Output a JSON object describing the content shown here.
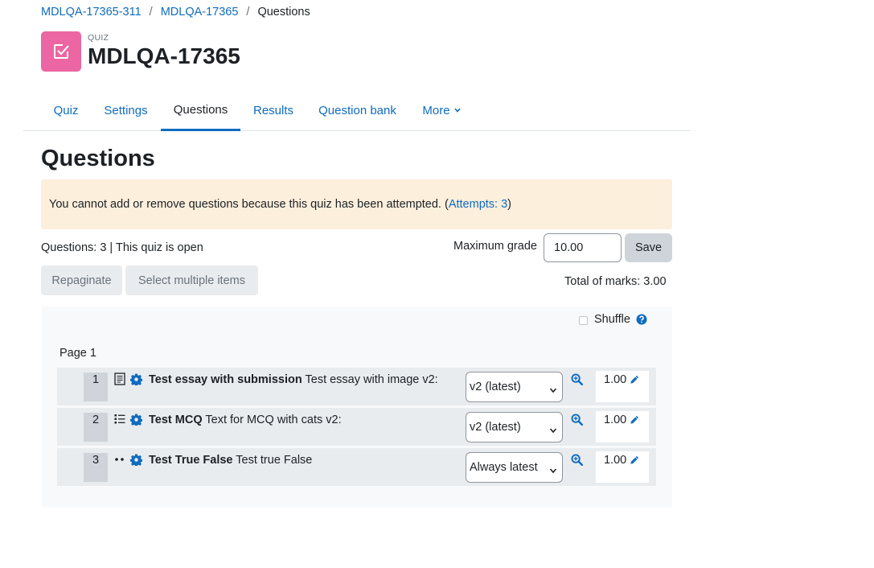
{
  "breadcrumb": {
    "item1": "MDLQA-17365-311",
    "item2": "MDLQA-17365",
    "current": "Questions",
    "sep": "/"
  },
  "header": {
    "kicker": "QUIZ",
    "title": "MDLQA-17365",
    "icon": "quiz-checkbox-icon"
  },
  "tabs": {
    "quiz": "Quiz",
    "settings": "Settings",
    "questions": "Questions",
    "results": "Results",
    "bank": "Question bank",
    "more": "More"
  },
  "page_heading": "Questions",
  "alert": {
    "text": "You cannot add or remove questions because this quiz has been attempted. (",
    "link": "Attempts: 3",
    "close_paren": ")"
  },
  "status_text": "Questions: 3 | This quiz is open",
  "max_grade": {
    "label": "Maximum grade",
    "value": "10.00",
    "save": "Save"
  },
  "buttons": {
    "repaginate": "Repaginate",
    "select_multiple": "Select multiple items"
  },
  "total_marks": "Total of marks: 3.00",
  "shuffle_label": "Shuffle",
  "page_label": "Page 1",
  "colors": {
    "accent": "#0f6cbf",
    "quiz_icon_bg": "#eb66a2",
    "alert_bg": "#fcefdc"
  },
  "questions": [
    {
      "num": "1",
      "icon": "essay-icon",
      "name": "Test essay with submission",
      "desc": "Test essay with image v2:",
      "version": "v2 (latest)",
      "mark": "1.00"
    },
    {
      "num": "2",
      "icon": "multichoice-icon",
      "name": "Test MCQ",
      "desc": "Text for MCQ with cats v2:",
      "version": "v2 (latest)",
      "mark": "1.00"
    },
    {
      "num": "3",
      "icon": "truefalse-icon",
      "name": "Test True False",
      "desc": "Test true False",
      "version": "Always latest",
      "mark": "1.00"
    }
  ]
}
